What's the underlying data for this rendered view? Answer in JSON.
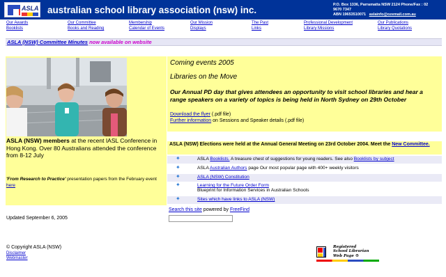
{
  "header": {
    "logo_text": "ASLA",
    "title": "australian school library association (nsw) inc.",
    "contact_line1": "P.O. Box 1336, Parramatta NSW 2124   Phone/Fax : 02",
    "contact_line2": "9670 7347",
    "contact_line3": "ABN 19653510071",
    "email": "aslainfo@ozemail.com.au"
  },
  "nav": [
    {
      "label": "Our Awards"
    },
    {
      "label": "Booklists"
    },
    {
      "label": "Our Committee"
    },
    {
      "label": "Books and Reading"
    },
    {
      "label": "Membership"
    },
    {
      "label": "Calendar of Events"
    },
    {
      "label": "Our Mission"
    },
    {
      "label": "Displays"
    },
    {
      "label": "The Past"
    },
    {
      "label": "Links"
    },
    {
      "label": "Professional Development"
    },
    {
      "label": "Library Missions"
    },
    {
      "label": "Our Publications"
    },
    {
      "label": "Library Quotations"
    }
  ],
  "minutes": {
    "link": "ASLA (NSW) Committee Minutes",
    "rest": " now available on website"
  },
  "left": {
    "photo_alt": "Three women smiling",
    "caption_bold": "ASLA (NSW) members",
    "caption_rest": " at the recent IASL Conference in Hong Kong. Over 80 Australians attended the conference from 8-12 July",
    "research_quote": "'From Research to Practice'",
    "research_rest": " presentation papers from the February event ",
    "research_link": "here"
  },
  "events": {
    "heading": "Coming events 2005",
    "sub": "Libraries on the Move",
    "body": "Our Annual PD day that gives attendees an opportunity to visit school libraries and hear a range speakers on a variety of topics is being held in North Sydney on 29th October",
    "flyer_link": "Download the flyer",
    "flyer_rest": " (.pdf file)",
    "info_link": "Further information",
    "info_rest": " on Sessions and Speaker details (.pdf file)"
  },
  "elections": {
    "text": "ASLA (NSW) Elections were held at the Annual General Meeting on 23rd October 2004. Meet the ",
    "link": "New Committee."
  },
  "links": [
    {
      "pre": "ASLA ",
      "link": "Booklists.",
      "post": " A treasure chest of suggestions for young readers. See also ",
      "link2": "Booklists by subject"
    },
    {
      "pre": "ASLA ",
      "link": "Australian Authors",
      "post": " page Our most popular page with 400+ weekly visitors"
    },
    {
      "link": "ASLA (NSW) Constitution"
    },
    {
      "link": "Learning for the Future Order Form",
      "line2": "Blueprint for Information Services in Australian Schools"
    },
    {
      "link": "Sites which have links to ASLA (NSW)"
    }
  ],
  "search": {
    "link": "Search this site",
    "mid": " powered by ",
    "provider": "FreeFind"
  },
  "footer": {
    "updated": "Updated September 6, 2005",
    "copyright": "© Copyright ASLA (NSW)",
    "disclaimer": "Disclaimer",
    "webmaster": "Webmaster"
  },
  "badge": {
    "line1": "Registered",
    "line2": "School Librarian",
    "line3": "Web Page  ®"
  }
}
